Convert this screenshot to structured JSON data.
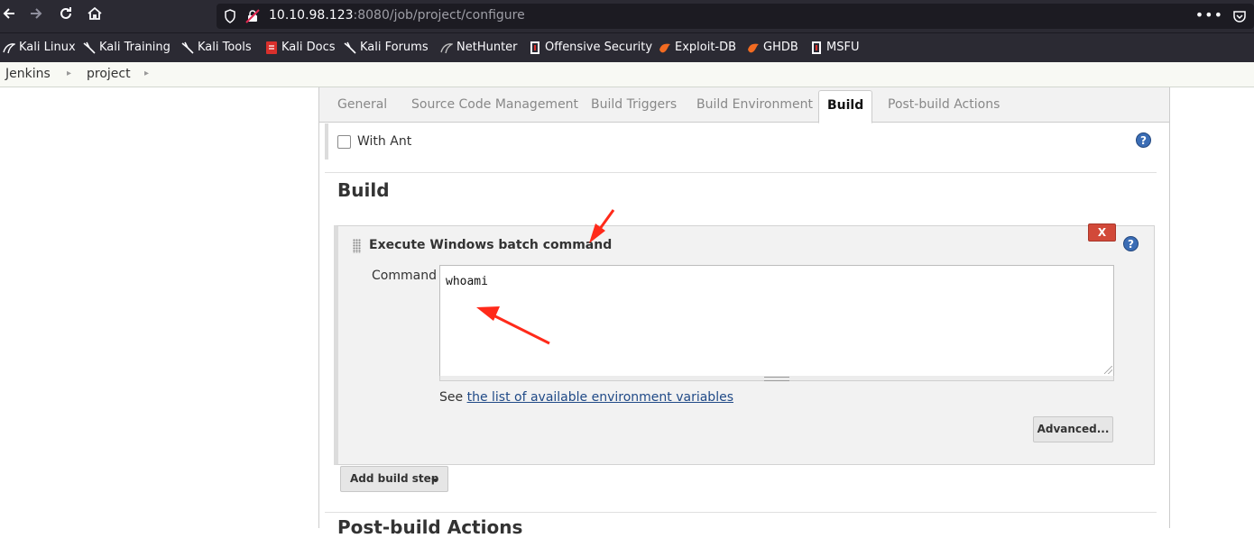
{
  "browser": {
    "url_host": "10.10.98.123",
    "url_rest": ":8080/job/project/configure",
    "menu_dots": "•••"
  },
  "bookmarks": [
    {
      "label": "Kali Linux",
      "icon": "kali-dragon-icon"
    },
    {
      "label": "Kali Training",
      "icon": "kali-dragon-icon"
    },
    {
      "label": "Kali Tools",
      "icon": "kali-dragon-icon"
    },
    {
      "label": "Kali Docs",
      "icon": "kali-docs-icon"
    },
    {
      "label": "Kali Forums",
      "icon": "kali-dragon-icon"
    },
    {
      "label": "NetHunter",
      "icon": "nethunter-icon"
    },
    {
      "label": "Offensive Security",
      "icon": "offsec-icon"
    },
    {
      "label": "Exploit-DB",
      "icon": "exploitdb-icon"
    },
    {
      "label": "GHDB",
      "icon": "exploitdb-icon"
    },
    {
      "label": "MSFU",
      "icon": "offsec-icon"
    }
  ],
  "breadcrumbs": [
    "Jenkins",
    "project"
  ],
  "tabs": [
    {
      "label": "General",
      "active": false
    },
    {
      "label": "Source Code Management",
      "active": false
    },
    {
      "label": "Build Triggers",
      "active": false
    },
    {
      "label": "Build Environment",
      "active": false
    },
    {
      "label": "Build",
      "active": true
    },
    {
      "label": "Post-build Actions",
      "active": false
    }
  ],
  "with_ant": {
    "label": "With Ant",
    "checked": false
  },
  "help_glyph": "?",
  "build_section": {
    "title": "Build",
    "step": {
      "title": "Execute Windows batch command",
      "delete_label": "X",
      "command_label": "Command",
      "command_value": "whoami",
      "env_prefix": "See ",
      "env_link": "the list of available environment variables",
      "advanced_label": "Advanced..."
    },
    "add_step_label": "Add build step"
  },
  "next_section_title": "Post-build Actions",
  "colors": {
    "chrome_bg": "#2b2a33",
    "link": "#204a87",
    "delete_red": "#d24939",
    "annotation_red": "#ff2a1a"
  }
}
